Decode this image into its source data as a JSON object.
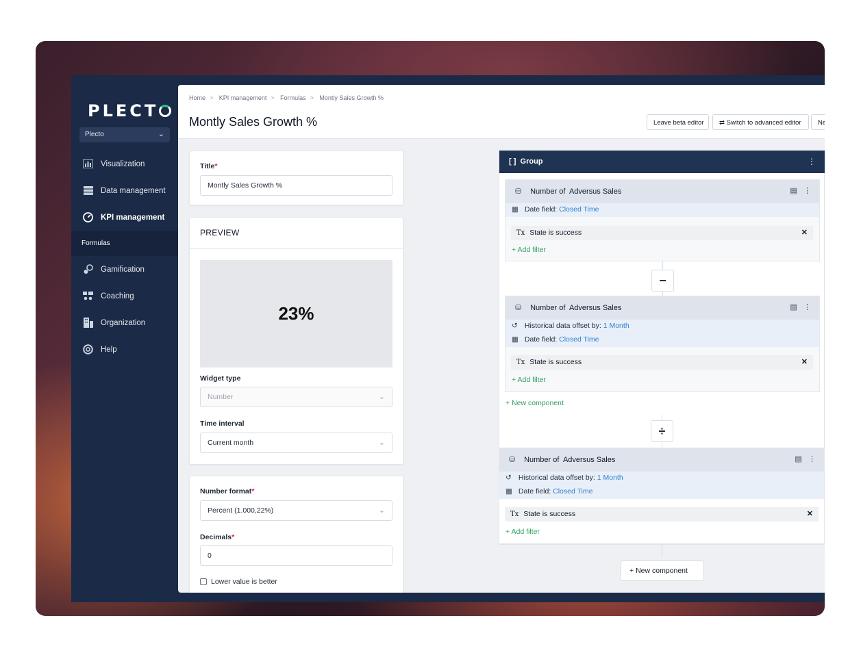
{
  "brand": {
    "logo": "PLECT"
  },
  "sidebar": {
    "org": "Plecto",
    "items": [
      {
        "label": "Visualization",
        "icon": "chart-icon"
      },
      {
        "label": "Data management",
        "icon": "database-icon"
      },
      {
        "label": "KPI management",
        "icon": "gauge-icon"
      },
      {
        "label": "Gamification",
        "icon": "gamification-icon"
      },
      {
        "label": "Coaching",
        "icon": "coaching-icon"
      },
      {
        "label": "Organization",
        "icon": "building-icon"
      },
      {
        "label": "Help",
        "icon": "lifebuoy-icon"
      }
    ],
    "sub_item": "Formulas"
  },
  "header": {
    "breadcrumbs": [
      "Home",
      "KPI management",
      "Formulas",
      "Montly Sales Growth %"
    ],
    "title": "Montly Sales Growth %",
    "leave_beta": "Leave beta editor",
    "switch_advanced": "Switch to advanced editor",
    "next_partial": "Ne"
  },
  "form": {
    "title_label": "Title",
    "title_value": "Montly Sales Growth %",
    "preview_label": "PREVIEW",
    "preview_value": "23%",
    "widget_type_label": "Widget type",
    "widget_type_value": "Number",
    "time_interval_label": "Time interval",
    "time_interval_value": "Current month",
    "number_format_label": "Number format",
    "number_format_value": "Percent (1.000,22%)",
    "decimals_label": "Decimals",
    "decimals_value": "0",
    "lower_better_label": "Lower value is better",
    "required_mark": "*"
  },
  "builder": {
    "group_label": "Group",
    "group_icon": "[ ]",
    "components": [
      {
        "prefix": "Number of",
        "source": "Adversus Sales",
        "date_label": "Date field:",
        "date_value": "Closed Time",
        "filter_field": "State",
        "filter_op": "is",
        "filter_value": "success",
        "add_filter": "Add filter"
      },
      {
        "prefix": "Number of",
        "source": "Adversus Sales",
        "offset_label": "Historical data offset by:",
        "offset_value": "1 Month",
        "date_label": "Date field:",
        "date_value": "Closed Time",
        "filter_field": "State",
        "filter_op": "is",
        "filter_value": "success",
        "add_filter": "Add filter"
      },
      {
        "prefix": "Number of",
        "source": "Adversus Sales",
        "offset_label": "Historical data offset by:",
        "offset_value": "1 Month",
        "date_label": "Date field:",
        "date_value": "Closed Time",
        "filter_field": "State",
        "filter_op": "is",
        "filter_value": "success",
        "add_filter": "Add filter"
      }
    ],
    "operators": {
      "subtract": "−",
      "divide": "÷"
    },
    "new_component": "New component",
    "add_symbol": "+",
    "remove_symbol": "✕",
    "kebab": "⋮",
    "filter_icon": "Tx",
    "db_icon": "⛁",
    "table_icon": "▤",
    "calendar_icon": "▦",
    "history_icon": "↺"
  },
  "colors": {
    "sidebar": "#1b2a47",
    "link": "#2f80d0",
    "add": "#2e9e5b",
    "required": "#e11d48"
  }
}
